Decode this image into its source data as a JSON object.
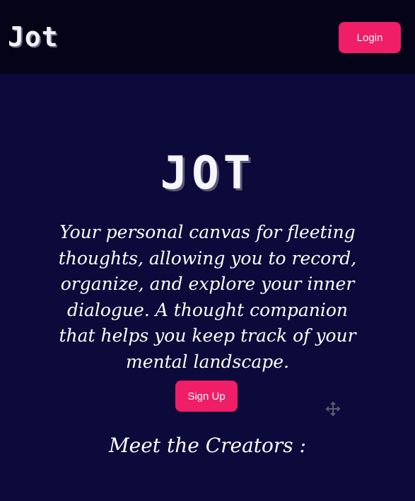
{
  "navbar": {
    "logo_text": "Jot",
    "login_label": "Login"
  },
  "hero": {
    "logo_text": "JOT",
    "tagline": "Your personal canvas for fleeting thoughts, allowing you to record, organize, and explore your inner dialogue. A thought companion that helps you keep track of your mental landscape.",
    "signup_label": "Sign Up"
  },
  "creators": {
    "heading": "Meet the Creators :"
  },
  "icons": {
    "move_cursor": "move-icon"
  },
  "colors": {
    "background": "#0b0a3a",
    "navbar": "#050317",
    "accent": "#f01d67"
  }
}
